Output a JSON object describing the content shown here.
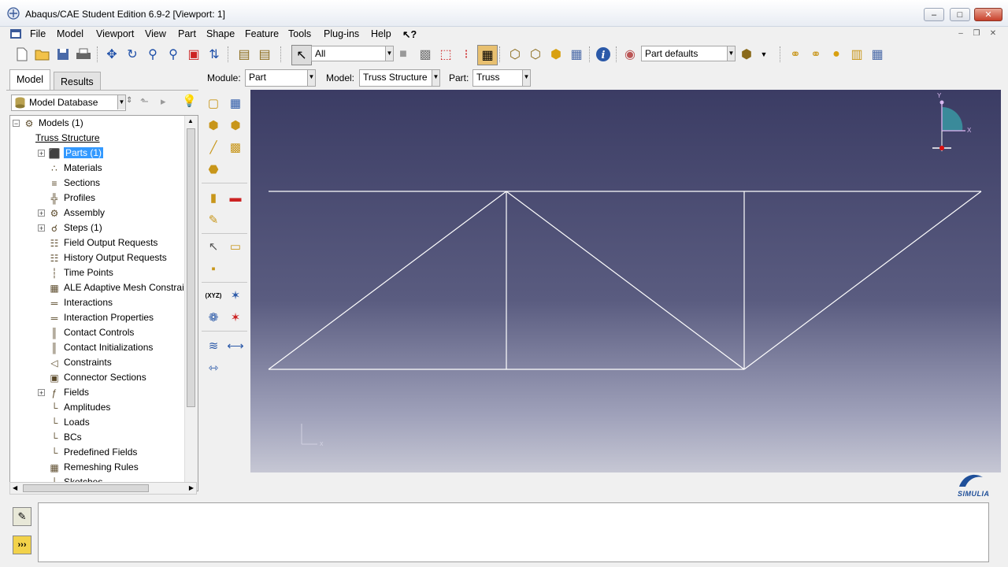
{
  "window": {
    "title": "Abaqus/CAE Student Edition 6.9-2 [Viewport: 1]",
    "minimize": "–",
    "maximize": "□",
    "close": "✕"
  },
  "menu": [
    {
      "label": "File"
    },
    {
      "label": "Model"
    },
    {
      "label": "Viewport"
    },
    {
      "label": "View"
    },
    {
      "label": "Part"
    },
    {
      "label": "Shape"
    },
    {
      "label": "Feature"
    },
    {
      "label": "Tools"
    },
    {
      "label": "Plug-ins"
    },
    {
      "label": "Help"
    },
    {
      "label": "↖?"
    }
  ],
  "toolbar": {
    "selection_filter": "All",
    "render_style": "Part defaults"
  },
  "tabs": {
    "model": "Model",
    "results": "Results"
  },
  "tree": {
    "database": "Model Database",
    "nodes": [
      {
        "label": "Models (1)",
        "icon": "models-icon",
        "glyph": "⚙"
      },
      {
        "label": "Truss Structure",
        "icon": "model-icon",
        "glyph": ""
      },
      {
        "label": "Parts (1)",
        "icon": "parts-icon",
        "glyph": "⬛",
        "selected": true
      },
      {
        "label": "Materials",
        "icon": "materials-icon",
        "glyph": "∴"
      },
      {
        "label": "Sections",
        "icon": "sections-icon",
        "glyph": "≡"
      },
      {
        "label": "Profiles",
        "icon": "profiles-icon",
        "glyph": "╬"
      },
      {
        "label": "Assembly",
        "icon": "assembly-icon",
        "glyph": "⚙"
      },
      {
        "label": "Steps (1)",
        "icon": "steps-icon",
        "glyph": "☌"
      },
      {
        "label": "Field Output Requests",
        "icon": "field-output-icon",
        "glyph": "☷"
      },
      {
        "label": "History Output Requests",
        "icon": "history-output-icon",
        "glyph": "☷"
      },
      {
        "label": "Time Points",
        "icon": "time-points-icon",
        "glyph": "┆"
      },
      {
        "label": "ALE Adaptive Mesh Constrai",
        "icon": "ale-mesh-icon",
        "glyph": "▦"
      },
      {
        "label": "Interactions",
        "icon": "interactions-icon",
        "glyph": "═"
      },
      {
        "label": "Interaction Properties",
        "icon": "interaction-properties-icon",
        "glyph": "═"
      },
      {
        "label": "Contact Controls",
        "icon": "contact-controls-icon",
        "glyph": "║"
      },
      {
        "label": "Contact Initializations",
        "icon": "contact-init-icon",
        "glyph": "║"
      },
      {
        "label": "Constraints",
        "icon": "constraints-icon",
        "glyph": "◁"
      },
      {
        "label": "Connector Sections",
        "icon": "connector-sections-icon",
        "glyph": "▣"
      },
      {
        "label": "Fields",
        "icon": "fields-icon",
        "glyph": "ƒ"
      },
      {
        "label": "Amplitudes",
        "icon": "amplitudes-icon",
        "glyph": "└"
      },
      {
        "label": "Loads",
        "icon": "loads-icon",
        "glyph": "└"
      },
      {
        "label": "BCs",
        "icon": "bcs-icon",
        "glyph": "└"
      },
      {
        "label": "Predefined Fields",
        "icon": "predefined-fields-icon",
        "glyph": "└"
      },
      {
        "label": "Remeshing Rules",
        "icon": "remeshing-icon",
        "glyph": "▦"
      },
      {
        "label": "Sketches",
        "icon": "sketches-icon",
        "glyph": "└"
      }
    ]
  },
  "modulebar": {
    "module_label": "Module:",
    "module_value": "Part",
    "model_label": "Model:",
    "model_value": "Truss Structure",
    "part_label": "Part:",
    "part_value": "Truss"
  },
  "viewport": {
    "triad_y": "Y",
    "triad_x": "X",
    "csys_x": "x"
  },
  "brand": {
    "logo_text": "SIMULIA"
  }
}
